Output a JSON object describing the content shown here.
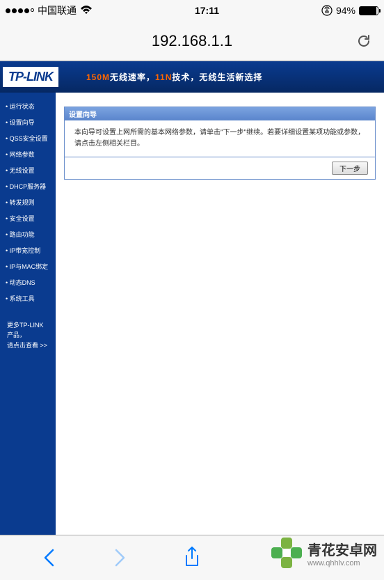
{
  "status": {
    "carrier": "中国联通",
    "time": "17:11",
    "battery_pct": "94%",
    "battery_fill_width": "94%"
  },
  "url_bar": {
    "url": "192.168.1.1"
  },
  "router": {
    "logo": "TP-LINK",
    "slogan_prefix": "150M",
    "slogan_mid": "无线速率，",
    "slogan_mid2": "11N",
    "slogan_suffix": "技术，无线生活新选择",
    "menu": [
      "运行状态",
      "设置向导",
      "QSS安全设置",
      "网络参数",
      "无线设置",
      "DHCP服务器",
      "转发规则",
      "安全设置",
      "路由功能",
      "IP带宽控制",
      "IP与MAC绑定",
      "动态DNS",
      "系统工具"
    ],
    "sidebar_footer_line1": "更多TP-LINK产品，",
    "sidebar_footer_link": "请点击查看 >>",
    "panel": {
      "title": "设置向导",
      "body": "本向导可设置上网所需的基本网络参数，请单击\"下一步\"继续。若要详细设置某项功能或参数，请点击左侧相关栏目。",
      "next_button": "下一步"
    }
  },
  "watermark": {
    "title": "青花安卓网",
    "url": "www.qhhlv.com"
  }
}
